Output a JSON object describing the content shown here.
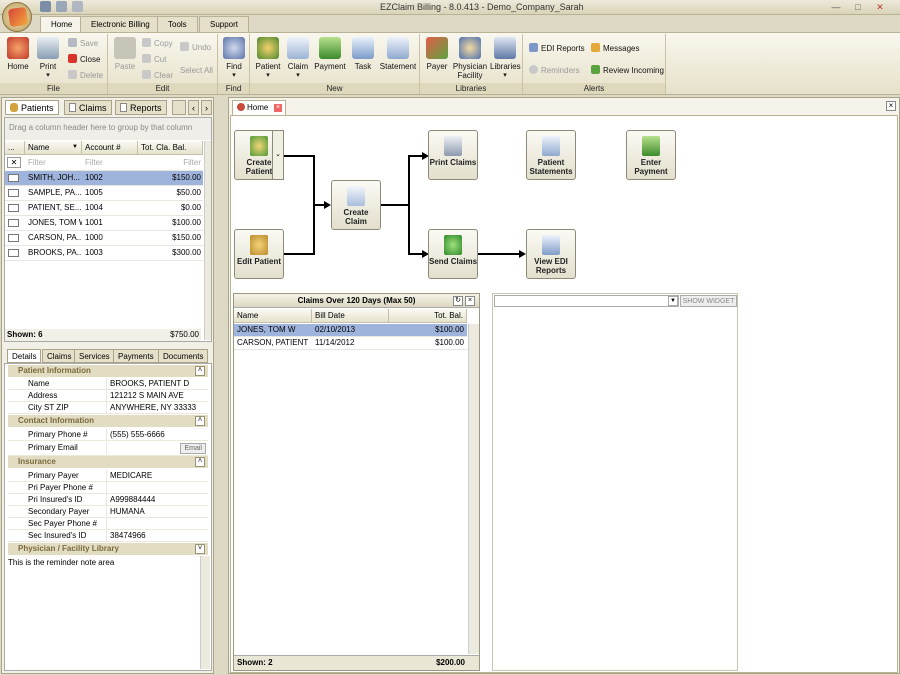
{
  "window": {
    "title": "EZClaim Billing - 8.0.413 - Demo_Company_Sarah"
  },
  "menu_tabs": [
    {
      "label": "Home"
    },
    {
      "label": "Electronic Billing"
    },
    {
      "label": "Tools"
    },
    {
      "label": "Support"
    }
  ],
  "ribbon": {
    "file": {
      "label": "File",
      "home": "Home",
      "print": "Print",
      "save": "Save",
      "close": "Close",
      "delete": "Delete"
    },
    "edit": {
      "label": "Edit",
      "paste": "Paste",
      "copy": "Copy",
      "cut": "Cut",
      "clear": "Clear",
      "undo": "Undo",
      "select_all": "Select All"
    },
    "find": {
      "label": "Find",
      "find": "Find"
    },
    "new": {
      "label": "New",
      "patient": "Patient",
      "claim": "Claim",
      "payment": "Payment",
      "task": "Task",
      "statement": "Statement"
    },
    "libraries": {
      "label": "Libraries",
      "payer": "Payer",
      "physician1": "Physician",
      "physician2": "Facility",
      "libraries": "Libraries"
    },
    "alerts": {
      "label": "Alerts",
      "edi_reports": "EDI Reports",
      "reminders": "Reminders",
      "messages": "Messages",
      "review_incoming": "Review Incoming"
    }
  },
  "left_tabs": [
    {
      "label": "Patients"
    },
    {
      "label": "Claims"
    },
    {
      "label": "Reports"
    }
  ],
  "patients_grid": {
    "group_hint": "Drag a column header here to group by that column",
    "columns": [
      "...",
      "Name",
      "Account #",
      "Tot. Cla. Bal."
    ],
    "filter": "Filter",
    "rows": [
      {
        "name": "SMITH, JOH...",
        "account": "1002",
        "balance": "$150.00"
      },
      {
        "name": "SAMPLE, PA...",
        "account": "1005",
        "balance": "$50.00"
      },
      {
        "name": "PATIENT, SE...",
        "account": "1004",
        "balance": "$0.00"
      },
      {
        "name": "JONES, TOM W",
        "account": "1001",
        "balance": "$100.00"
      },
      {
        "name": "CARSON, PA...",
        "account": "1000",
        "balance": "$150.00"
      },
      {
        "name": "BROOKS, PA...",
        "account": "1003",
        "balance": "$300.00"
      }
    ],
    "shown": "Shown: 6",
    "total": "$750.00"
  },
  "detail_tabs": [
    {
      "label": "Details"
    },
    {
      "label": "Claims"
    },
    {
      "label": "Services"
    },
    {
      "label": "Payments"
    },
    {
      "label": "Documents"
    }
  ],
  "details": {
    "patient_info": {
      "title": "Patient Information",
      "name_label": "Name",
      "name": "BROOKS, PATIENT D",
      "address_label": "Address",
      "address": "121212 S MAIN AVE",
      "city_label": "City ST ZIP",
      "city": "ANYWHERE, NY 33333"
    },
    "contact": {
      "title": "Contact Information",
      "phone_label": "Primary Phone #",
      "phone": "(555) 555-6666",
      "email_label": "Primary Email",
      "email_button": "Email"
    },
    "insurance": {
      "title": "Insurance",
      "primary_payer_label": "Primary Payer",
      "primary_payer": "MEDICARE",
      "pri_phone_label": "Pri Payer Phone #",
      "pri_insured_label": "Pri Insured's ID",
      "pri_insured": "A999884444",
      "sec_payer_label": "Secondary Payer",
      "sec_payer": "HUMANA",
      "sec_phone_label": "Sec Payer Phone #",
      "sec_insured_label": "Sec Insured's ID",
      "sec_insured": "38474966"
    },
    "physician": {
      "title": "Physician / Facility Library"
    },
    "reminder": "This is the reminder note area"
  },
  "home_tab": {
    "label": "Home"
  },
  "workflow": {
    "create_patient": "Create Patient",
    "edit_patient": "Edit Patient",
    "create_claim": "Create Claim",
    "print_claims": "Print Claims",
    "send_claims": "Send Claims",
    "patient_statements": "Patient Statements",
    "view_edi_reports": "View EDI Reports",
    "enter_payment": "Enter Payment"
  },
  "claims_widget": {
    "title": "Claims Over 120 Days (Max 50)",
    "columns": [
      "Name",
      "Bill Date",
      "Tot. Bal."
    ],
    "rows": [
      {
        "name": "JONES, TOM W",
        "date": "02/10/2013",
        "balance": "$100.00"
      },
      {
        "name": "CARSON, PATIENT",
        "date": "11/14/2012",
        "balance": "$100.00"
      }
    ],
    "shown": "Shown: 2",
    "total": "$200.00"
  },
  "widget_picker": {
    "button": "SHOW WIDGET"
  }
}
